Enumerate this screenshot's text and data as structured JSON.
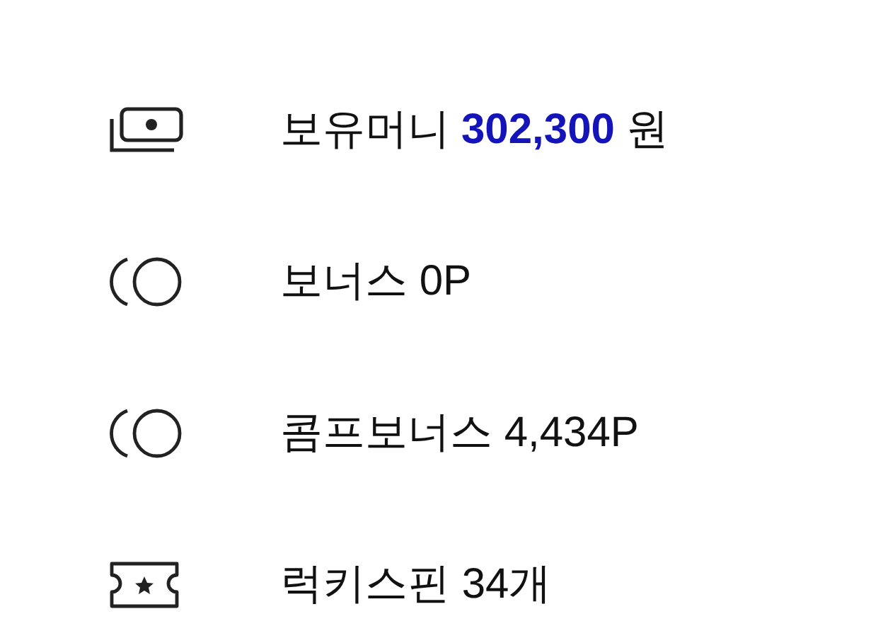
{
  "items": [
    {
      "kind": "money",
      "label": "보유머니",
      "amount": "302,300",
      "unit": "원"
    },
    {
      "kind": "coin",
      "label": "보너스 0P"
    },
    {
      "kind": "coin",
      "label": "콤프보너스 4,434P"
    },
    {
      "kind": "ticket",
      "label": "럭키스핀 34개"
    }
  ]
}
